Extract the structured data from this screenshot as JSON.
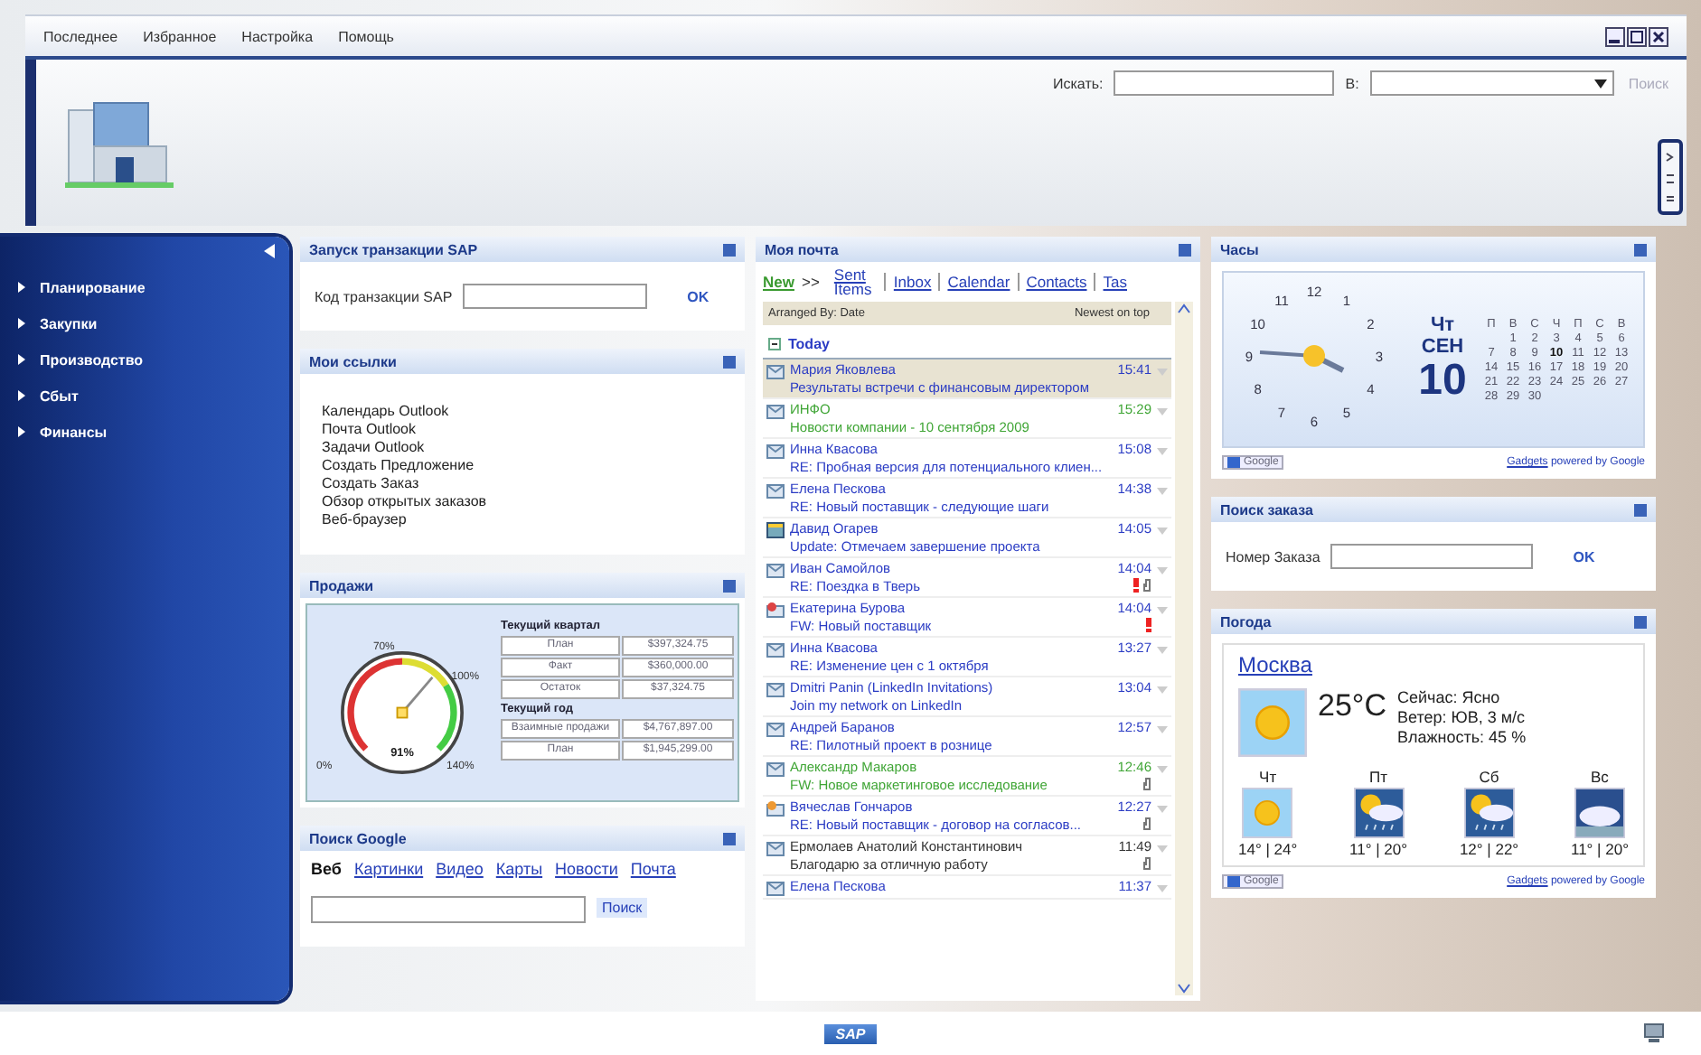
{
  "menu": [
    {
      "label": "Последнее"
    },
    {
      "label": "Избранное"
    },
    {
      "label": "Настройка"
    },
    {
      "label": "Помощь"
    }
  ],
  "search": {
    "label": "Искать:",
    "in_label": "В:",
    "button": "Поиск",
    "button_disabled": true
  },
  "nav": {
    "items": [
      {
        "label": "Планирование"
      },
      {
        "label": "Закупки"
      },
      {
        "label": "Производство"
      },
      {
        "label": "Сбыт"
      },
      {
        "label": "Финансы"
      }
    ]
  },
  "sap_panel": {
    "title": "Запуск транзакции SAP",
    "field_label": "Код транзакции SAP",
    "button": "OK"
  },
  "links_panel": {
    "title": "Мои ссылки",
    "links": [
      "Календарь Outlook",
      "Почта Outlook",
      "Задачи Outlook",
      "Создать Предложение",
      "Создать Заказ",
      "Обзор открытых заказов",
      "Веб-браузер"
    ]
  },
  "sales_panel": {
    "title": "Продажи",
    "gauge": {
      "level": 0.65,
      "scale_labels": [
        "0%",
        "70%",
        "100%",
        "140%"
      ],
      "reading": "91%"
    },
    "groups": [
      {
        "title": "Текущий квартал",
        "rows": [
          {
            "label": "План",
            "value": "$397,324.75"
          },
          {
            "label": "Факт",
            "value": "$360,000.00"
          },
          {
            "label": "Остаток",
            "value": "$37,324.75"
          }
        ]
      },
      {
        "title": "Текущий год",
        "rows": [
          {
            "label": "Взаимные продажи",
            "value": "$4,767,897.00"
          },
          {
            "label": "План",
            "value": "$1,945,299.00"
          }
        ]
      }
    ]
  },
  "google_panel": {
    "title": "Поиск Google",
    "tabs": [
      {
        "label": "Веб",
        "selected": true
      },
      {
        "label": "Картинки",
        "selected": false
      },
      {
        "label": "Видео",
        "selected": false
      },
      {
        "label": "Карты",
        "selected": false
      },
      {
        "label": "Новости",
        "selected": false
      },
      {
        "label": "Почта",
        "selected": false
      }
    ],
    "button": "Поиск"
  },
  "mail_panel": {
    "title": "Моя почта",
    "new_label": "New",
    "arrow": ">>",
    "folders": [
      {
        "label": "Sent Items"
      },
      {
        "label": "Inbox"
      },
      {
        "label": "Calendar"
      },
      {
        "label": "Contacts"
      },
      {
        "label": "Tas"
      }
    ],
    "arranged_by": "Arranged By: Date",
    "sort": "Newest on top",
    "group": "Today",
    "messages": [
      {
        "kind": "mail",
        "sender": "Мария Яковлева",
        "time": "15:41",
        "subject": "Результаты встречи с финансовым директором",
        "color": "#2b3cc4",
        "selected": true,
        "important": false,
        "attachment": false
      },
      {
        "kind": "mail",
        "sender": "ИНФО",
        "time": "15:29",
        "subject": "Новости компании - 10 сентября 2009",
        "color": "#3fa535",
        "selected": false,
        "important": false,
        "attachment": false
      },
      {
        "kind": "mail",
        "sender": "Инна Квасова",
        "time": "15:08",
        "subject": "RE: Пробная версия для потенциального клиен...",
        "color": "#2b3cc4",
        "selected": false,
        "important": false,
        "attachment": false
      },
      {
        "kind": "mail",
        "sender": "Елена Пескова",
        "time": "14:38",
        "subject": "RE: Новый поставщик - следующие шаги",
        "color": "#2b3cc4",
        "selected": false,
        "important": false,
        "attachment": false
      },
      {
        "kind": "meeting",
        "sender": "Давид Огарев",
        "time": "14:05",
        "subject": "Update: Отмечаем завершение проекта",
        "color": "#2b3cc4",
        "selected": false,
        "important": false,
        "attachment": false
      },
      {
        "kind": "mail",
        "sender": "Иван Самойлов",
        "time": "14:04",
        "subject": "RE: Поездка в Тверь",
        "color": "#2b3cc4",
        "selected": false,
        "important": true,
        "attachment": true
      },
      {
        "kind": "reply",
        "sender": "Екатерина Бурова",
        "time": "14:04",
        "subject": "FW: Новый поставщик",
        "color": "#2b3cc4",
        "selected": false,
        "important": true,
        "attachment": false
      },
      {
        "kind": "mail",
        "sender": "Инна Квасова",
        "time": "13:27",
        "subject": "RE: Изменение цен с 1 октября",
        "color": "#2b3cc4",
        "selected": false,
        "important": false,
        "attachment": false
      },
      {
        "kind": "mail",
        "sender": "Dmitri Panin (LinkedIn Invitations)",
        "time": "13:04",
        "subject": "Join my network on LinkedIn",
        "color": "#2b3cc4",
        "selected": false,
        "important": false,
        "attachment": false
      },
      {
        "kind": "mail",
        "sender": "Андрей Баранов",
        "time": "12:57",
        "subject": "RE: Пилотный проект в рознице",
        "color": "#2b3cc4",
        "selected": false,
        "important": false,
        "attachment": false
      },
      {
        "kind": "mail",
        "sender": "Александр Макаров",
        "time": "12:46",
        "subject": "FW: Новое маркетинговое исследование",
        "color": "#3fa535",
        "selected": false,
        "important": false,
        "attachment": true
      },
      {
        "kind": "forward",
        "sender": "Вячеслав Гончаров",
        "time": "12:27",
        "subject": "RE: Новый поставщик - договор на согласов...",
        "color": "#2b3cc4",
        "selected": false,
        "important": false,
        "attachment": true
      },
      {
        "kind": "mail",
        "sender": "Ермолаев Анатолий Константинович",
        "time": "11:49",
        "subject": "Благодарю за отличную работу",
        "color": "#333333",
        "selected": false,
        "important": false,
        "attachment": true
      },
      {
        "kind": "mail",
        "sender": "Елена Пескова",
        "time": "11:37",
        "color": "#2b3cc4",
        "selected": false,
        "important": false,
        "attachment": false
      }
    ]
  },
  "clock_panel": {
    "title": "Часы",
    "numbers": [
      "12",
      "1",
      "2",
      "3",
      "4",
      "5",
      "6",
      "7",
      "8",
      "9",
      "10",
      "11"
    ],
    "weekday": "Чт",
    "month": "СЕН",
    "date": "10",
    "calendar": {
      "weekdays": [
        "П",
        "В",
        "С",
        "Ч",
        "П",
        "С",
        "В"
      ],
      "weeks": [
        [
          {
            "d": "1",
            "selected": false
          },
          {
            "d": "2",
            "selected": false
          },
          {
            "d": "3",
            "selected": false
          },
          {
            "d": "4",
            "selected": false
          },
          {
            "d": "5",
            "selected": false
          },
          {
            "d": "6",
            "selected": false
          }
        ],
        [
          {
            "d": "7",
            "selected": false
          },
          {
            "d": "8",
            "selected": false
          },
          {
            "d": "9",
            "selected": false
          },
          {
            "d": "10",
            "selected": true
          },
          {
            "d": "11",
            "selected": false
          },
          {
            "d": "12",
            "selected": false
          },
          {
            "d": "13",
            "selected": false
          }
        ],
        [
          {
            "d": "14",
            "selected": false
          },
          {
            "d": "15",
            "selected": false
          },
          {
            "d": "16",
            "selected": false
          },
          {
            "d": "17",
            "selected": false
          },
          {
            "d": "18",
            "selected": false
          },
          {
            "d": "19",
            "selected": false
          },
          {
            "d": "20",
            "selected": false
          }
        ],
        [
          {
            "d": "21",
            "selected": false
          },
          {
            "d": "22",
            "selected": false
          },
          {
            "d": "23",
            "selected": false
          },
          {
            "d": "24",
            "selected": false
          },
          {
            "d": "25",
            "selected": false
          },
          {
            "d": "26",
            "selected": false
          },
          {
            "d": "27",
            "selected": false
          }
        ],
        [
          {
            "d": "28",
            "selected": false
          },
          {
            "d": "29",
            "selected": false
          },
          {
            "d": "30",
            "selected": false
          }
        ]
      ]
    },
    "google_button": "Google",
    "gadgets_link": "Gadgets",
    "powered": "powered by Google"
  },
  "order_panel": {
    "title": "Поиск заказа",
    "field_label": "Номер Заказа",
    "button": "OK"
  },
  "weather_panel": {
    "title": "Погода",
    "city": "Москва",
    "kind": "sunny",
    "temperature": "25°C",
    "details": [
      "Сейчас: Ясно",
      "Ветер: ЮВ, 3 м/с",
      "Влажность: 45 %"
    ],
    "forecast": [
      {
        "day": "Чт",
        "kind": "sunny",
        "temps": "14° | 24°"
      },
      {
        "day": "Пт",
        "kind": "rain",
        "temps": "11° | 20°"
      },
      {
        "day": "Сб",
        "kind": "rain",
        "temps": "12° | 22°"
      },
      {
        "day": "Вс",
        "kind": "cloudy",
        "temps": "11° | 20°"
      }
    ],
    "google_button": "Google",
    "gadgets_link": "Gadgets",
    "powered": "powered by Google"
  },
  "footer": {
    "logo": "SAP"
  }
}
